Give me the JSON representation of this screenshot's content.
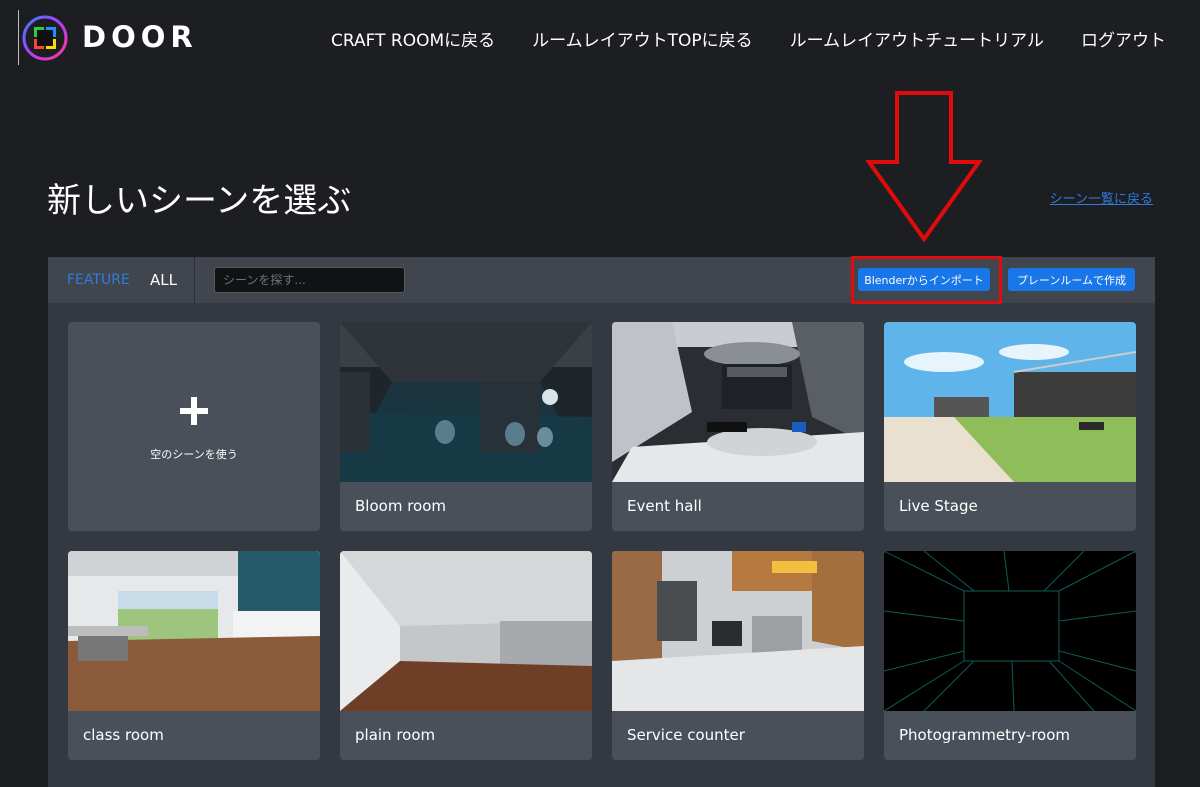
{
  "brand": {
    "name": "DOOR"
  },
  "nav": [
    {
      "label": "CRAFT ROOMに戻る"
    },
    {
      "label": "ルームレイアウトTOPに戻る"
    },
    {
      "label": "ルームレイアウトチュートリアル"
    },
    {
      "label": "ログアウト"
    }
  ],
  "page": {
    "title": "新しいシーンを選ぶ",
    "back_link": "シーン一覧に戻る"
  },
  "toolbar": {
    "tab_feature": "FEATURE",
    "tab_all": "ALL",
    "search_placeholder": "シーンを探す...",
    "blender_button": "Blenderからインポート",
    "plane_button": "プレーンルームで作成"
  },
  "cards": [
    {
      "label": "空のシーンを使う",
      "icon": "plus-icon"
    },
    {
      "label": "Bloom room"
    },
    {
      "label": "Event hall"
    },
    {
      "label": "Live Stage"
    },
    {
      "label": "class room"
    },
    {
      "label": "plain room"
    },
    {
      "label": "Service counter"
    },
    {
      "label": "Photogrammetry-room"
    }
  ],
  "colors": {
    "background": "#1d1e22",
    "panel": "#343941",
    "accent": "#1976e8",
    "link": "#2f7bdc",
    "annotation": "#e20b0b"
  }
}
